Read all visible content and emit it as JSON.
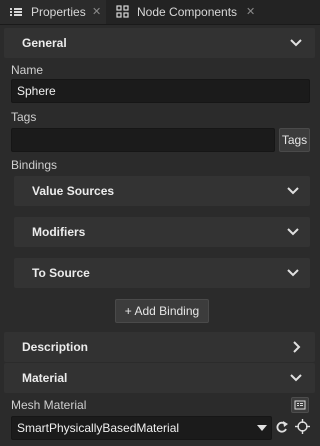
{
  "tabs": [
    {
      "label": "Properties",
      "close": "✕"
    },
    {
      "label": "Node Components",
      "close": "✕"
    }
  ],
  "general": {
    "title": "General",
    "name_label": "Name",
    "name_value": "Sphere",
    "tags_label": "Tags",
    "tags_value": "",
    "tags_button": "Tags",
    "bindings_label": "Bindings",
    "bindings": [
      {
        "label": "Value Sources"
      },
      {
        "label": "Modifiers"
      },
      {
        "label": "To Source"
      }
    ],
    "add_binding": "+ Add Binding"
  },
  "description": {
    "title": "Description"
  },
  "material": {
    "title": "Material",
    "mesh_material_label": "Mesh Material",
    "mesh_material_value": "SmartPhysicallyBasedMaterial"
  },
  "colors": {
    "background": "#2b2b2b",
    "header": "#323232",
    "input": "#1b1b1b"
  }
}
